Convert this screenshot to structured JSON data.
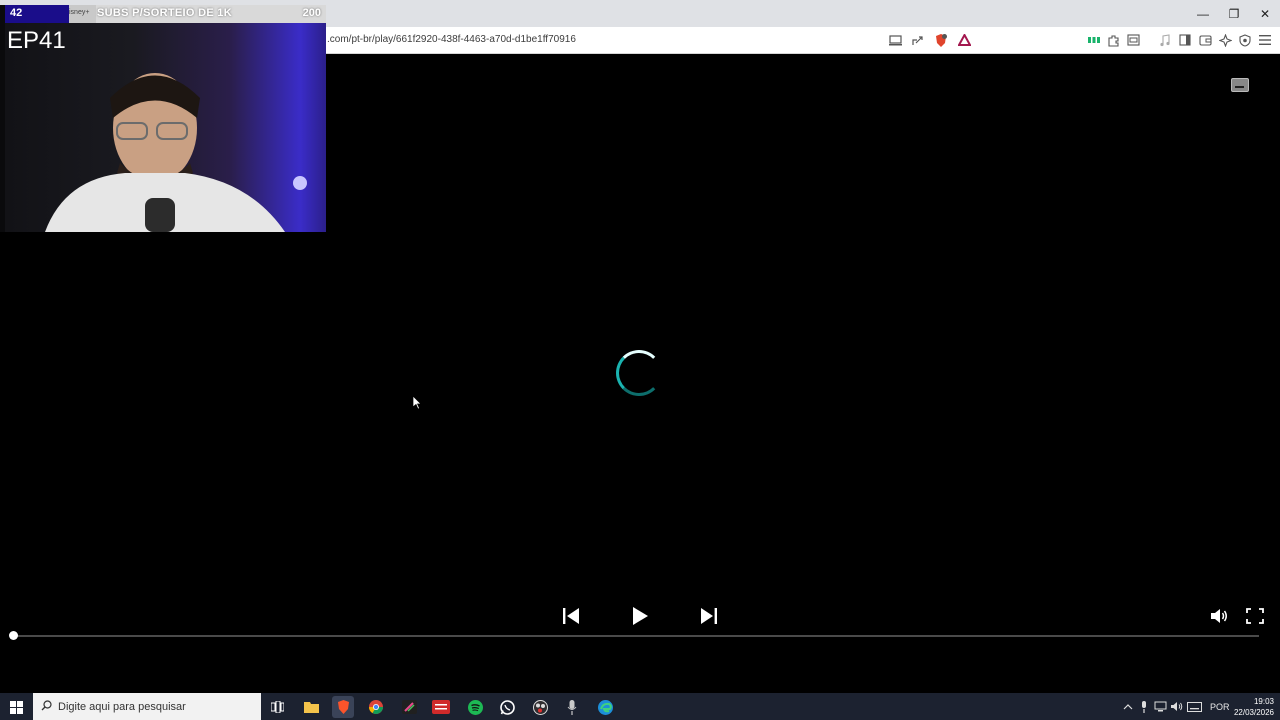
{
  "browser": {
    "url": ".com/pt-br/play/661f2920-438f-4463-a70d-d1be1ff70916"
  },
  "window_controls": {
    "minimize": "—",
    "restore": "❐",
    "close": "✕"
  },
  "overlay": {
    "sub_count": "42",
    "small_label": "isney+",
    "title": "SUBS P/SORTEIO DE 1K",
    "goal": "200",
    "episode": "EP41"
  },
  "player": {
    "progress_fraction": 0.0,
    "state": "loading"
  },
  "taskbar": {
    "search_placeholder": "Digite aqui para pesquisar",
    "language": "POR",
    "time": "19:03",
    "date": "22/03/2026"
  },
  "colors": {
    "spinner_accent": "#1ab3b0",
    "overlay_counter_bg": "#1a0d8a",
    "taskbar_bg": "#1c2230"
  }
}
